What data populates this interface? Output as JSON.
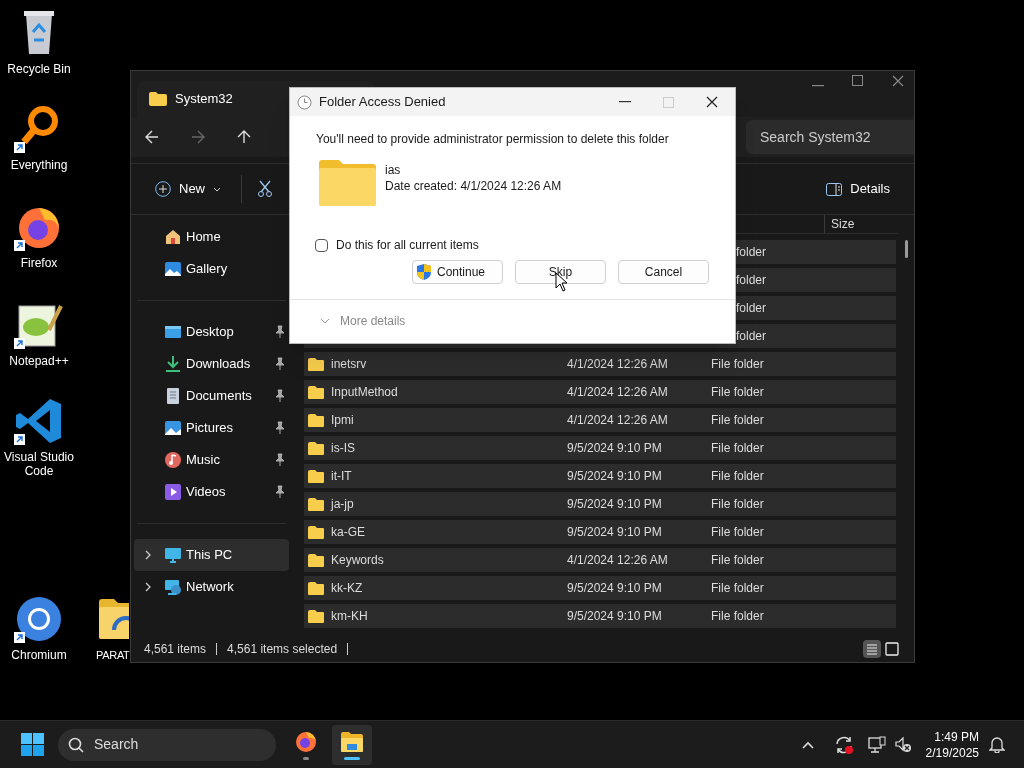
{
  "desktop_icons": [
    {
      "label": "Recycle Bin",
      "kind": "recycle",
      "shortcut": false
    },
    {
      "label": "Everything",
      "kind": "everything",
      "shortcut": true
    },
    {
      "label": "Firefox",
      "kind": "firefox",
      "shortcut": true
    },
    {
      "label": "Notepad++",
      "kind": "notepad",
      "shortcut": true
    },
    {
      "label": "Visual Studio Code",
      "kind": "vscode",
      "shortcut": true
    },
    {
      "label": "Chromium",
      "kind": "chromium",
      "shortcut": true
    },
    {
      "label": "PARAT",
      "kind": "folder",
      "shortcut": false
    }
  ],
  "explorer": {
    "tab_title": "System32",
    "search": {
      "placeholder": "Search System32"
    },
    "toolbar": {
      "new_label": "New",
      "details_label": "Details"
    },
    "nav_groups": [
      [
        {
          "label": "Home",
          "pinned": false,
          "expandable": false,
          "selected": false
        },
        {
          "label": "Gallery",
          "pinned": false,
          "expandable": false,
          "selected": false
        }
      ],
      [
        {
          "label": "Desktop",
          "pinned": true,
          "expandable": false,
          "selected": false
        },
        {
          "label": "Downloads",
          "pinned": true,
          "expandable": false,
          "selected": false
        },
        {
          "label": "Documents",
          "pinned": true,
          "expandable": false,
          "selected": false
        },
        {
          "label": "Pictures",
          "pinned": true,
          "expandable": false,
          "selected": false
        },
        {
          "label": "Music",
          "pinned": true,
          "expandable": false,
          "selected": false
        },
        {
          "label": "Videos",
          "pinned": true,
          "expandable": false,
          "selected": false
        }
      ],
      [
        {
          "label": "This PC",
          "pinned": false,
          "expandable": true,
          "selected": true
        },
        {
          "label": "Network",
          "pinned": false,
          "expandable": true,
          "selected": false
        }
      ]
    ],
    "columns": {
      "column_4": "Size"
    },
    "rows": [
      {
        "type": "folder",
        "selected": true
      },
      {
        "type": "folder",
        "selected": true
      },
      {
        "type": "folder",
        "selected": true
      },
      {
        "type": "folder",
        "selected": true
      },
      {
        "name": "inetsrv",
        "date": "4/1/2024 12:26 AM",
        "type": "File folder",
        "selected": true
      },
      {
        "name": "InputMethod",
        "date": "4/1/2024 12:26 AM",
        "type": "File folder",
        "selected": true
      },
      {
        "name": "Ipmi",
        "date": "4/1/2024 12:26 AM",
        "type": "File folder",
        "selected": true
      },
      {
        "name": "is-IS",
        "date": "9/5/2024 9:10 PM",
        "type": "File folder",
        "selected": true
      },
      {
        "name": "it-IT",
        "date": "9/5/2024 9:10 PM",
        "type": "File folder",
        "selected": true
      },
      {
        "name": "ja-jp",
        "date": "9/5/2024 9:10 PM",
        "type": "File folder",
        "selected": true
      },
      {
        "name": "ka-GE",
        "date": "9/5/2024 9:10 PM",
        "type": "File folder",
        "selected": true
      },
      {
        "name": "Keywords",
        "date": "4/1/2024 12:26 AM",
        "type": "File folder",
        "selected": true
      },
      {
        "name": "kk-KZ",
        "date": "9/5/2024 9:10 PM",
        "type": "File folder",
        "selected": true
      },
      {
        "name": "km-KH",
        "date": "9/5/2024 9:10 PM",
        "type": "File folder",
        "selected": true
      }
    ],
    "status": {
      "items": "4,561 items",
      "selected": "4,561 items selected"
    },
    "view_modes": [
      {
        "kind": "details",
        "selected": true
      },
      {
        "kind": "tiles",
        "selected": false
      }
    ]
  },
  "dialog": {
    "title": "Folder Access Denied",
    "message": "You'll need to provide administrator permission to delete this folder",
    "file_name": "ias",
    "date_created": "Date created: 4/1/2024 12:26 AM",
    "checkbox": {
      "label": "Do this for all current items",
      "checked": false
    },
    "buttons": [
      {
        "label": "Continue",
        "kind": "shield"
      },
      {
        "label": "Skip",
        "kind": "plain"
      },
      {
        "label": "Cancel",
        "kind": "plain"
      }
    ],
    "more_details": "More details"
  },
  "taskbar": {
    "search_placeholder": "Search",
    "apps": [
      {
        "kind": "firefox",
        "active": false
      },
      {
        "kind": "explorer",
        "active": true
      }
    ],
    "time": "1:49 PM",
    "date": "2/19/2025"
  }
}
